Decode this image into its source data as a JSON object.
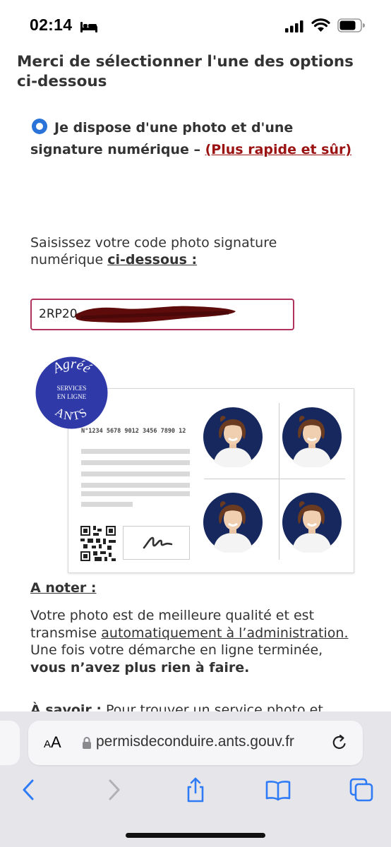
{
  "status_bar": {
    "time": "02:14",
    "icons": [
      "bed-icon",
      "cellular-signal-icon",
      "wifi-icon",
      "battery-icon"
    ]
  },
  "heading": "Merci de sélectionner l'une des options ci-dessous",
  "option": {
    "text": "Je dispose d'une photo et d'une signature numérique –",
    "highlight": "(Plus rapide et sûr)",
    "selected": true
  },
  "code_prompt": {
    "text": "Saisissez votre code photo signature numérique",
    "emphasis": "ci-dessous :"
  },
  "code_input": {
    "value": "2RP20"
  },
  "seal": {
    "top": "Agréé",
    "line1": "SERVICES",
    "line2": "EN LIGNE",
    "bottom": "ANTS"
  },
  "card": {
    "number": "N°1234 5678 9012 3456 7890 12"
  },
  "note": {
    "title": "A noter :",
    "line1": "Votre photo est de meilleure qualité et est transmise",
    "link": "automatiquement à l’administration.",
    "line2": "Une fois votre démarche en ligne terminée,",
    "bold": "vous n’avez plus rien à faire."
  },
  "savoir": {
    "label": "À savoir :",
    "text": "Pour trouver un service photo et"
  },
  "browser": {
    "aa_big": "A",
    "aa_small": "A",
    "url": "permisdeconduire.ants.gouv.fr"
  },
  "colors": {
    "radio": "#2a73d8",
    "link_red": "#9b1212",
    "input_border": "#b1325e",
    "seal_blue": "#2f3aa8",
    "toolbar_blue": "#2f7bf5"
  }
}
